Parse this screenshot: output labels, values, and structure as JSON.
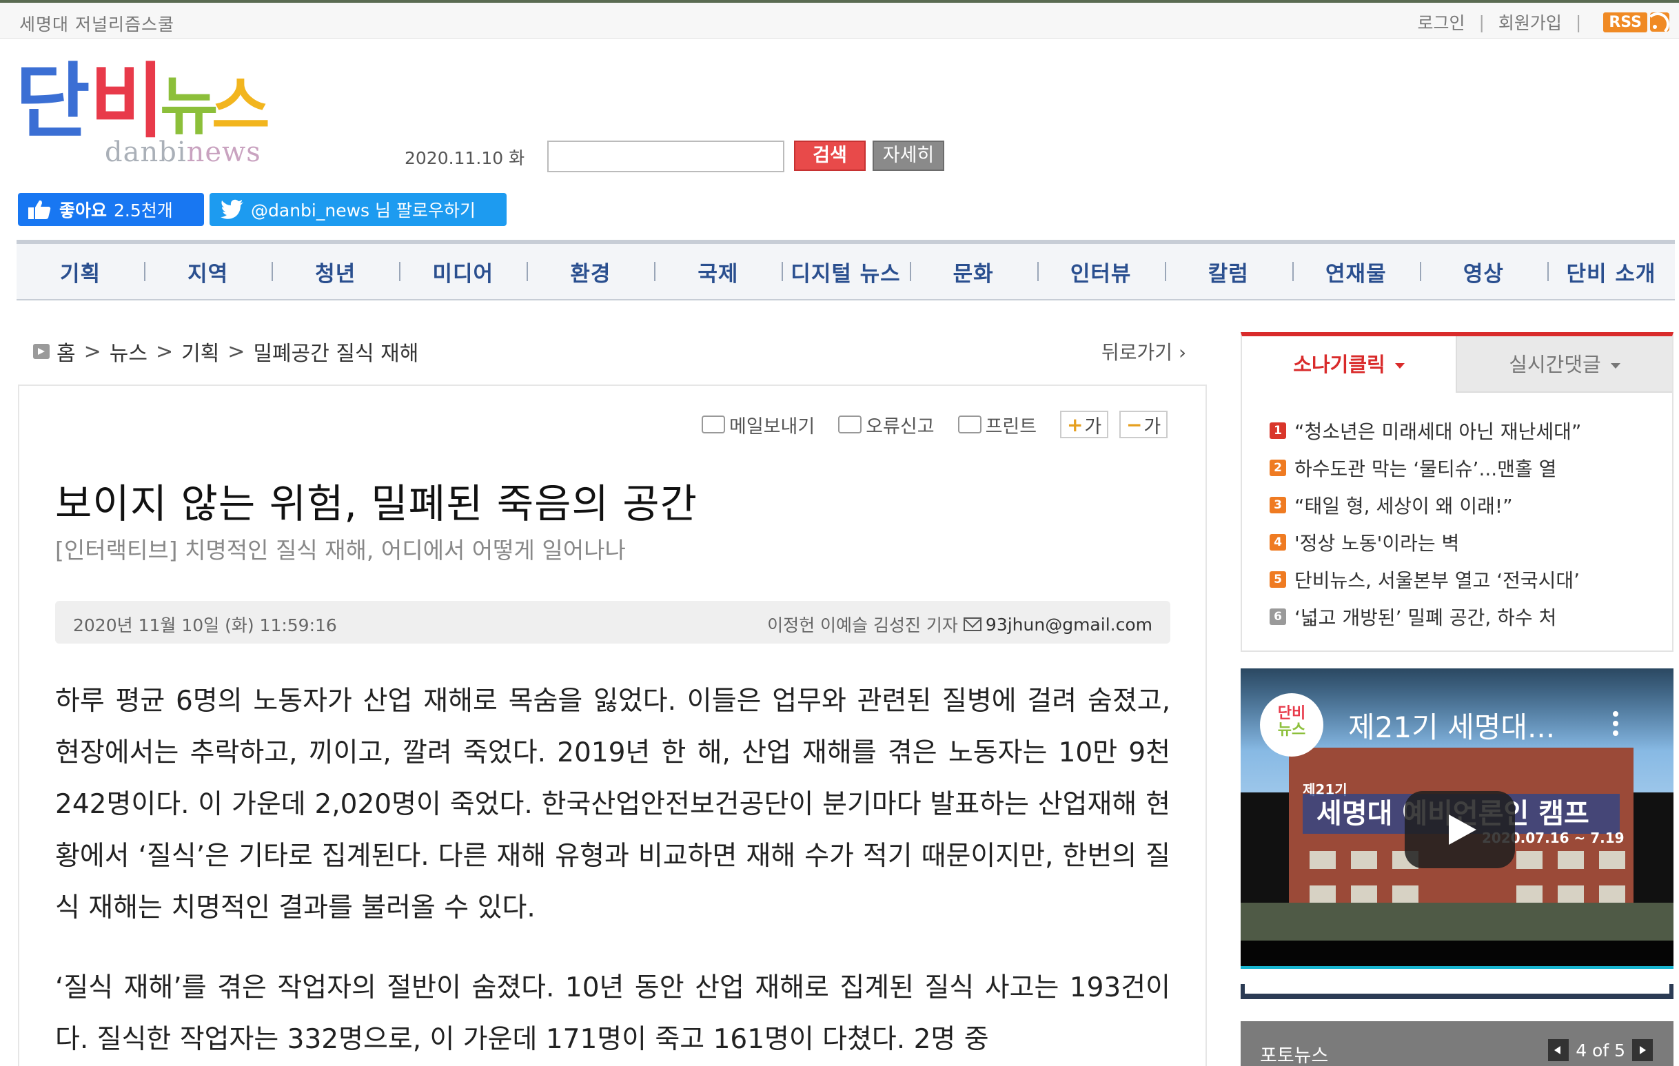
{
  "topbar": {
    "site_title": "세명대 저널리즘스쿨",
    "login": "로그인",
    "signup": "회원가입",
    "separator": "|",
    "rss": "RSS"
  },
  "logo": {
    "korean": [
      "단",
      "비",
      "뉴",
      "스"
    ],
    "english_a": "danbi",
    "english_b": "news",
    "colors": [
      "#3b6fd4",
      "#e83a4a",
      "#8cbf3a",
      "#f2b51e"
    ]
  },
  "search": {
    "date": "2020.11.10 화",
    "value": "",
    "button": "검색",
    "detail_button": "자세히"
  },
  "social": {
    "like_label": "좋아요",
    "like_count": "2.5천개",
    "twitter_label": "@danbi_news 님 팔로우하기"
  },
  "nav": {
    "items": [
      "기획",
      "지역",
      "청년",
      "미디어",
      "환경",
      "국제",
      "디지털 뉴스",
      "문화",
      "인터뷰",
      "칼럼",
      "연재물",
      "영상",
      "단비 소개"
    ]
  },
  "breadcrumb": {
    "items": [
      "홈",
      "뉴스",
      "기획",
      "밀폐공간 질식 재해"
    ],
    "separator": ">",
    "back": "뒤로가기"
  },
  "tools": {
    "email": "메일보내기",
    "report": "오류신고",
    "print": "프린트",
    "zoom_in_sign": "+",
    "zoom_out_sign": "−",
    "zoom_glyph": "가"
  },
  "article": {
    "headline": "보이지 않는 위험, 밀폐된 죽음의 공간",
    "subhead": "[인터랙티브] 치명적인 질식 재해, 어디에서 어떻게 일어나나",
    "datetime": "2020년 11월 10일 (화) 11:59:16",
    "byline": "이정헌 이예슬 김성진 기자",
    "email": "93jhun@gmail.com",
    "paragraphs": [
      "하루 평균 6명의 노동자가 산업 재해로 목숨을 잃었다. 이들은 업무와 관련된 질병에 걸려 숨졌고, 현장에서는 추락하고, 끼이고, 깔려 죽었다. 2019년 한 해, 산업 재해를 겪은 노동자는 10만 9천 242명이다. 이 가운데 2,020명이 죽었다. 한국산업안전보건공단이 분기마다 발표하는 산업재해 현황에서 ‘질식’은 기타로 집계된다. 다른 재해 유형과 비교하면 재해 수가 적기 때문이지만, 한번의 질식 재해는 치명적인 결과를 불러올 수 있다.",
      "‘질식 재해’를 겪은 작업자의 절반이 숨졌다. 10년 동안 산업 재해로 집계된 질식 사고는 193건이다. 질식한 작업자는 332명으로, 이 가운데 171명이 죽고 161명이 다쳤다. 2명 중"
    ]
  },
  "sidebar": {
    "tab_popular": "소나기클릭",
    "tab_comments": "실시간댓글",
    "ranking": [
      {
        "num": "1",
        "title": "“청소년은 미래세대 아닌 재난세대”",
        "color": "#d9362b"
      },
      {
        "num": "2",
        "title": "하수도관 막는 ‘물티슈’...맨홀 열",
        "color": "#ef7b22"
      },
      {
        "num": "3",
        "title": "“태일 형, 세상이 왜 이래!”",
        "color": "#ef7b22"
      },
      {
        "num": "4",
        "title": "'정상 노동'이라는 벽",
        "color": "#ef7b22"
      },
      {
        "num": "5",
        "title": "단비뉴스, 서울본부 열고 ‘전국시대’",
        "color": "#ef7b22"
      },
      {
        "num": "6",
        "title": "‘넓고 개방된’ 밀폐 공간, 하수 처",
        "color": "#9a9a9a"
      }
    ],
    "video": {
      "channel_line1": "단비",
      "channel_line2": "뉴스",
      "title": "제21기 세명대...",
      "banner_small": "제21기",
      "banner": "세명대 예비언론인 캠프",
      "dates": "2020.07.16 ~ 7.19"
    },
    "photo_news": {
      "label": "포토뉴스",
      "page": "4 of 5"
    }
  }
}
